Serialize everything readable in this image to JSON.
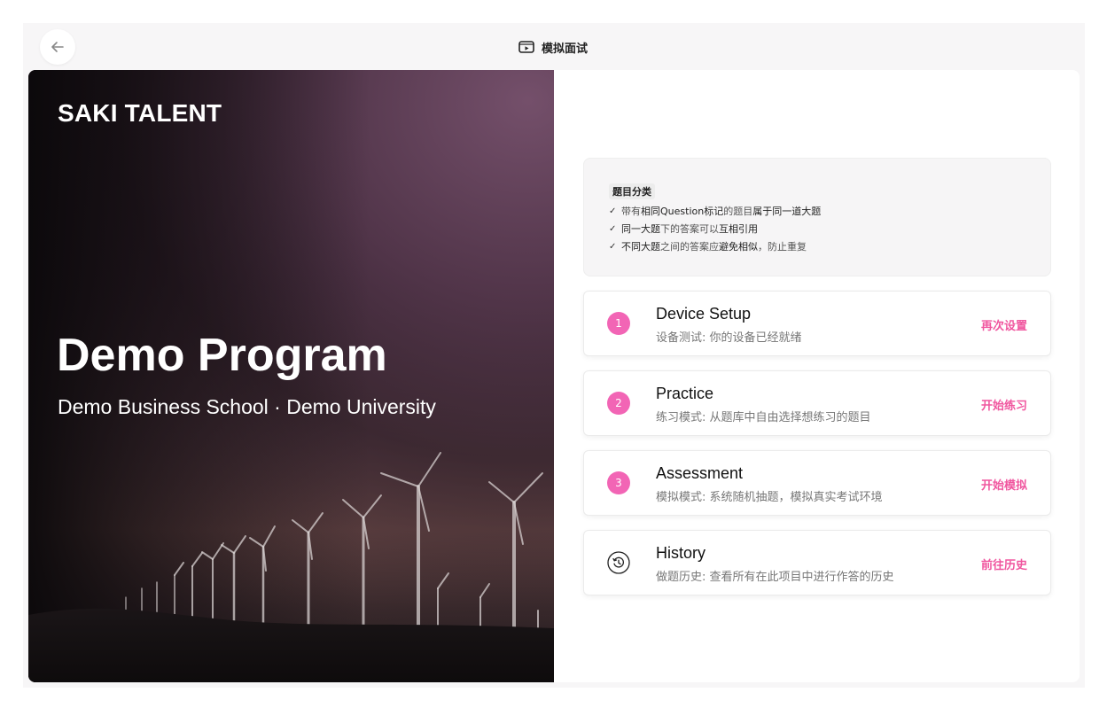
{
  "topbar": {
    "title": "模拟面试",
    "back_icon": "arrow-left-icon",
    "title_icon": "video-play-icon"
  },
  "hero": {
    "brand": "SAKI TALENT",
    "program_title": "Demo Program",
    "program_subtitle": "Demo Business School · Demo University"
  },
  "info": {
    "badge": "题目分类",
    "lines": [
      {
        "pre": "带有",
        "hl1": "相同Question标记",
        "mid": "的题目",
        "hl2": "属于同一道大题",
        "post": ""
      },
      {
        "pre": "",
        "hl1": "同一大题",
        "mid": "下的答案可以",
        "hl2": "互相引用",
        "post": ""
      },
      {
        "pre": "",
        "hl1": "不同大题",
        "mid": "之间的答案应",
        "hl2": "避免相似",
        "post": "，防止重复"
      }
    ]
  },
  "steps": [
    {
      "number": "1",
      "title": "Device Setup",
      "desc": "设备测试: 你的设备已经就绪",
      "action": "再次设置"
    },
    {
      "number": "2",
      "title": "Practice",
      "desc": "练习模式: 从题库中自由选择想练习的题目",
      "action": "开始练习"
    },
    {
      "number": "3",
      "title": "Assessment",
      "desc": "模拟模式: 系统随机抽题，模拟真实考试环境",
      "action": "开始模拟"
    },
    {
      "icon": "history-icon",
      "title": "History",
      "desc": "做题历史: 查看所有在此项目中进行作答的历史",
      "action": "前往历史"
    }
  ],
  "colors": {
    "accent": "#f265b5",
    "action_text": "#f0569f"
  }
}
